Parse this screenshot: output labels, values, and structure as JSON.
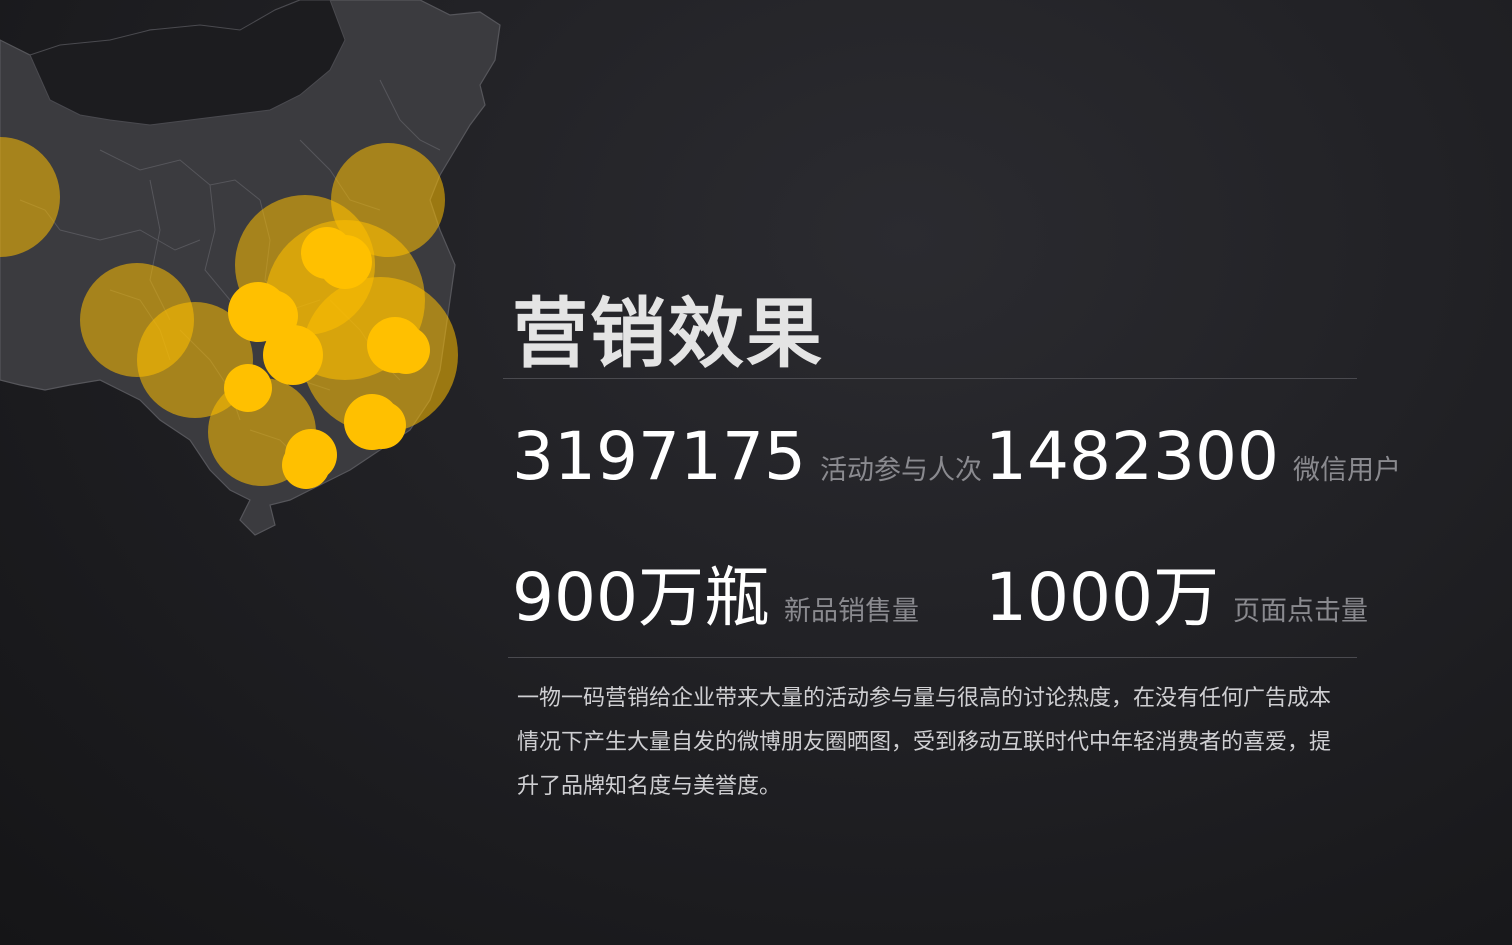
{
  "title": "营销效果",
  "stats": [
    {
      "value": "3197175",
      "label": "活动参与人次"
    },
    {
      "value": "1482300",
      "label": "微信用户"
    },
    {
      "value": "900万瓶",
      "label": "新品销售量"
    },
    {
      "value": "1000万",
      "label": "页面点击量"
    }
  ],
  "description": "一物一码营销给企业带来大量的活动参与量与很高的讨论热度，在没有任何广告成本情况下产生大量自发的微博朋友圈晒图，受到移动互联时代中年轻消费者的喜爱，提升了品牌知名度与美誉度。",
  "colors": {
    "accent": "#ffc000",
    "map_fill": "#3a3a3e",
    "map_stroke": "#55555a"
  }
}
